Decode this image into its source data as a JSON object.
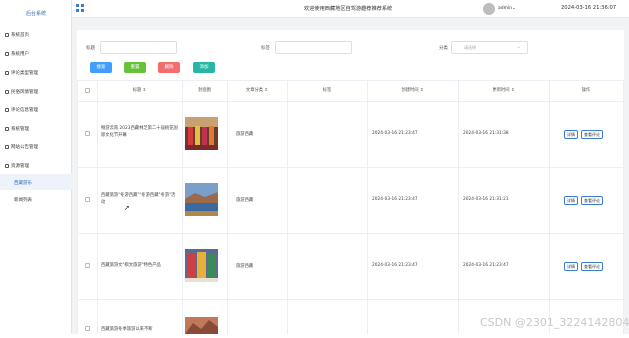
{
  "sidebar": {
    "title": "后台系统",
    "items": [
      {
        "label": "系统首页"
      },
      {
        "label": "系统用户"
      },
      {
        "label": "评论类型管理"
      },
      {
        "label": "民俗风情管理"
      },
      {
        "label": "评论信息管理"
      },
      {
        "label": "系统管理"
      },
      {
        "label": "网站公告管理"
      },
      {
        "label": "资源管理"
      },
      {
        "label": "西藏游乐"
      },
      {
        "label": "新闻列表"
      }
    ]
  },
  "topbar": {
    "title": "欢迎使用西藏地区自驾游趣荐推荐系统",
    "user": "admin",
    "time": "2024-03-16 21:36:07"
  },
  "filters": {
    "title_label": "标题",
    "tag_label": "标签",
    "category_label": "分类",
    "category_placeholder": "请选择"
  },
  "buttons": {
    "search": "搜索",
    "reset": "重置",
    "delete": "删除",
    "add": "添加"
  },
  "table": {
    "headers": [
      "标题",
      "封面图",
      "文章分类",
      "标签",
      "创建时间",
      "更新时间",
      "操作"
    ],
    "rows": [
      {
        "title": "畅游云南 2023西藏林芝第二十届桃花国际文化节开幕",
        "category": "旅游西藏",
        "tag": "",
        "created": "2024-03-16 21:23:47",
        "updated": "2024-03-16 21:31:38",
        "action1": "详情",
        "action2": "查看评论"
      },
      {
        "title": "西藏旅游\"冬游西藏\"\"冬游西藏\"冬游\"活动",
        "category": "旅游西藏",
        "tag": "",
        "created": "2024-03-16 21:23:47",
        "updated": "2024-03-16 21:31:21",
        "action1": "详情",
        "action2": "查看评论"
      },
      {
        "title": "西藏旅游文\"棋文旅游\"特色产品",
        "category": "旅游西藏",
        "tag": "",
        "created": "2024-03-16 21:23:47",
        "updated": "2024-03-16 21:23:47",
        "action1": "详情",
        "action2": "查看评论"
      },
      {
        "title": "西藏旅游冬季旅游以来不断",
        "category": "",
        "tag": "",
        "created": "",
        "updated": "",
        "action1": "",
        "action2": ""
      }
    ]
  },
  "watermark": "CSDN @2301_3224142804",
  "colors": {
    "accent": "#3a7bd5",
    "search_btn": "#409eff",
    "reset_btn": "#67c23a",
    "delete_btn": "#f56c6c",
    "add_btn": "#26b7a6"
  }
}
